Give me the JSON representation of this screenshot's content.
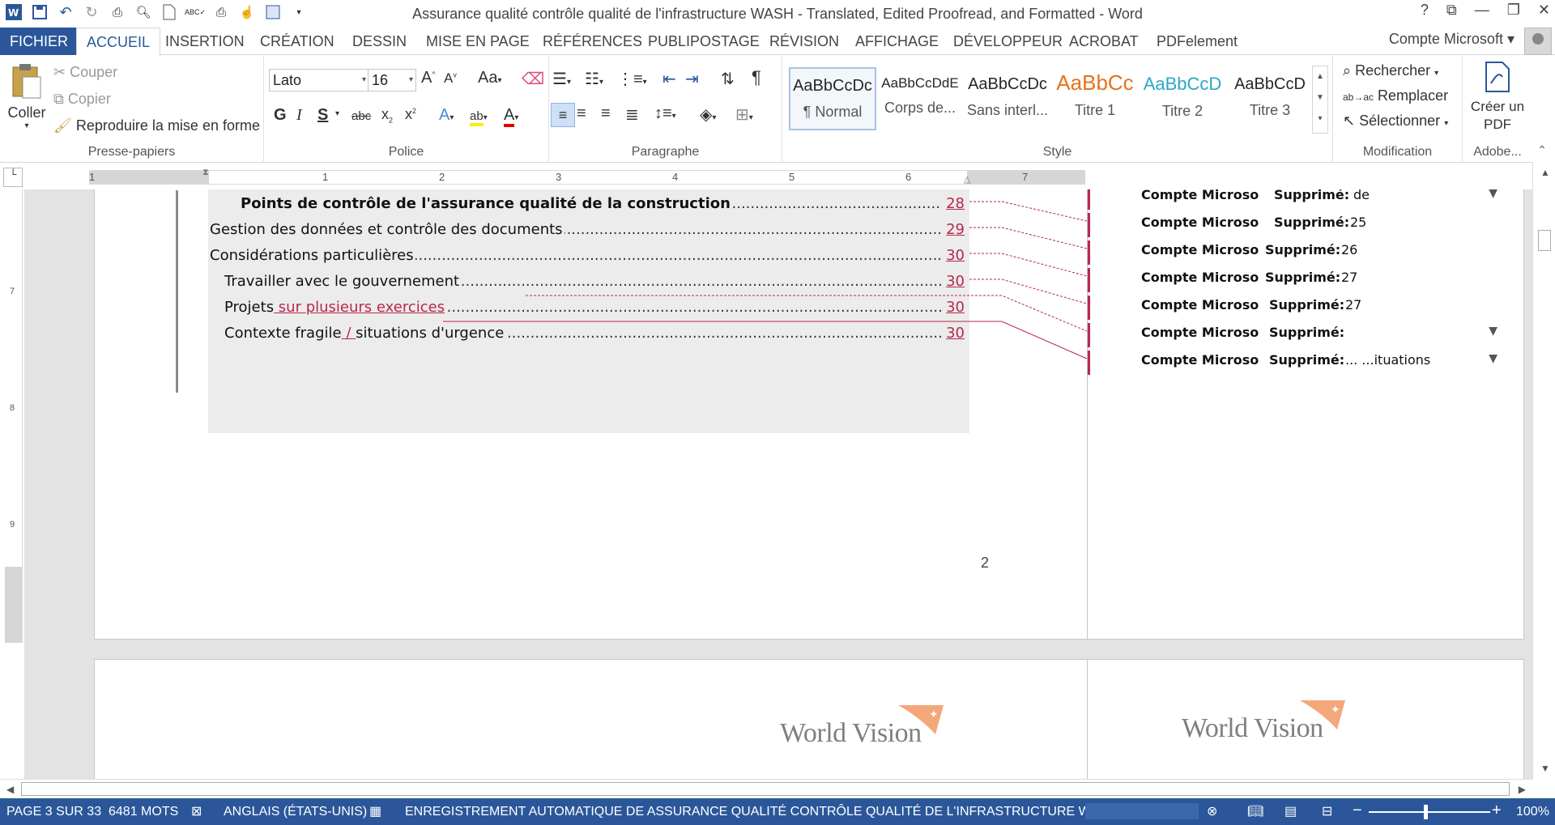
{
  "window": {
    "title": "Assurance qualité  contrôle qualité de l'infrastructure WASH - Translated, Edited Proofread, and Formatted - Word",
    "controls": [
      "?",
      "⧉",
      "—",
      "❐",
      "✕"
    ]
  },
  "tabs": [
    "FICHIER",
    "ACCUEIL",
    "INSERTION",
    "CRÉATION",
    "DESSIN",
    "MISE EN PAGE",
    "RÉFÉRENCES",
    "PUBLIPOSTAGE",
    "RÉVISION",
    "AFFICHAGE",
    "DÉVELOPPEUR",
    "ACROBAT",
    "PDFelement"
  ],
  "active_tab": "ACCUEIL",
  "account": "Compte Microsoft",
  "ribbon": {
    "clipboard": {
      "paste": "Coller",
      "cut": "Couper",
      "copy": "Copier",
      "format_painter": "Reproduire la mise en forme",
      "label": "Presse-papiers"
    },
    "font": {
      "name": "Lato",
      "size": "16",
      "label": "Police",
      "case": "Aa"
    },
    "paragraph": {
      "label": "Paragraphe"
    },
    "styles": {
      "label": "Style",
      "items": [
        {
          "sample": "AaBbCcDc",
          "name": "¶ Normal",
          "color": "#000000"
        },
        {
          "sample": "AaBbCcDdE",
          "name": "Corps de...",
          "color": "#000000"
        },
        {
          "sample": "AaBbCcDc",
          "name": "Sans interl...",
          "color": "#000000"
        },
        {
          "sample": "AaBbCc",
          "name": "Titre 1",
          "color": "#e8711c"
        },
        {
          "sample": "AaBbCcD",
          "name": "Titre 2",
          "color": "#2aa8c4"
        },
        {
          "sample": "AaBbCcD",
          "name": "Titre 3",
          "color": "#000000"
        }
      ]
    },
    "editing": {
      "find": "Rechercher",
      "replace": "Remplacer",
      "select": "Sélectionner",
      "label": "Modification"
    },
    "adobe": {
      "create_pdf": "Créer un PDF",
      "label": "Adobe..."
    }
  },
  "ruler": {
    "h_numbers": [
      "1",
      "1",
      "2",
      "3",
      "4",
      "5",
      "6",
      "7"
    ],
    "v_numbers": [
      "7",
      "8",
      "9"
    ]
  },
  "toc": [
    {
      "label": "Points de contrôle de l'assurance qualité de la construction",
      "page": "28",
      "bold": true
    },
    {
      "label": "Gestion des données et contrôle des documents",
      "page": "29",
      "bold": false
    },
    {
      "label": "Considérations particulières",
      "page": "30",
      "bold": false
    },
    {
      "label": "Travailler avec le gouvernement",
      "page": "30",
      "bold": false
    },
    {
      "label_prefix": "Projets",
      "label_insert": " sur plusieurs exercices",
      "page": "30",
      "bold": false
    },
    {
      "label_prefix": "Contexte fragile",
      "label_insert": " / ",
      "label_suffix": "situations d'urgence",
      "page": "30",
      "bold": false
    }
  ],
  "page_number": "2",
  "comments": [
    {
      "author": "Compte Microso",
      "kind": "Supprimé:",
      "value": "de",
      "expandable": true
    },
    {
      "author": "Compte Microso",
      "kind": "Supprimé:",
      "value": "25",
      "expandable": false
    },
    {
      "author": "Compte Microso",
      "kind": "Supprimé:",
      "value": "26",
      "expandable": false
    },
    {
      "author": "Compte Microso",
      "kind": "Supprimé:",
      "value": "27",
      "expandable": false
    },
    {
      "author": "Compte Microso",
      "kind": "Supprimé:",
      "value": "27",
      "expandable": false
    },
    {
      "author": "Compte Microso",
      "kind": "Supprimé:",
      "value": "",
      "expandable": true
    },
    {
      "author": "Compte Microso",
      "kind": "Supprimé:",
      "value": "...  ...ituations",
      "expandable": true
    }
  ],
  "logo_text": "World Vision",
  "status": {
    "page": "PAGE 3 SUR 33",
    "words": "6481 MOTS",
    "language": "ANGLAIS (ÉTATS-UNIS)",
    "autosave": "ENREGISTREMENT AUTOMATIQUE DE ASSURANCE QUALITÉ  CONTRÔLE QUALITÉ DE L'INFRASTRUCTURE WASH - TR...",
    "zoom": "100%"
  },
  "colors": {
    "accent": "#2b579a",
    "revision": "#b8274c",
    "logo_flag": "#f4a77a"
  }
}
